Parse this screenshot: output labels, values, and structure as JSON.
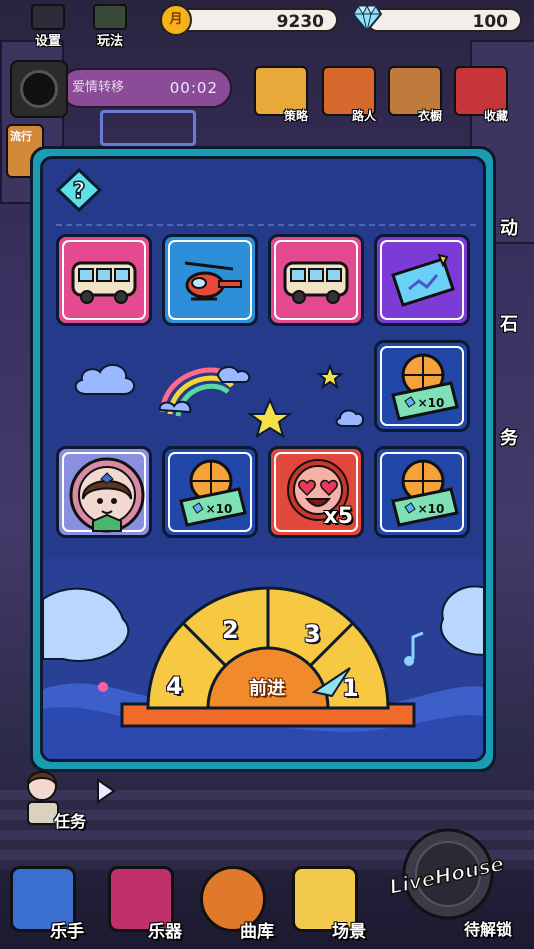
{
  "top_bar": {
    "settings_label": "设置",
    "howto_label": "玩法",
    "coin_glyph": "月",
    "coins": "9230",
    "gems": "100"
  },
  "song": {
    "title": "爱情转移",
    "time": "00:02"
  },
  "top_tabs": [
    {
      "label": "策略",
      "icon": "folder-icon",
      "color": "#e9a83a"
    },
    {
      "label": "路人",
      "icon": "passerby-icon",
      "color": "#d7692f"
    },
    {
      "label": "衣橱",
      "icon": "wardrobe-icon",
      "color": "#c07a3c"
    },
    {
      "label": "收藏",
      "icon": "gramophone-icon",
      "color": "#c6353a"
    }
  ],
  "side": {
    "left_trend_label": "流行",
    "right_partial_1": "动",
    "right_partial_2": "石",
    "right_partial_3": "务"
  },
  "board": {
    "help_glyph": "?",
    "rows": [
      [
        {
          "kind": "bus",
          "bg": "pink"
        },
        {
          "kind": "helicopter",
          "bg": "blue"
        },
        {
          "kind": "bus",
          "bg": "pink"
        },
        {
          "kind": "ticket",
          "bg": "purple"
        }
      ],
      [
        {
          "kind": "pizza-ticket",
          "bg": "navy",
          "ticket_text": "×10"
        }
      ],
      [
        {
          "kind": "avatar-badge",
          "bg": "lav"
        },
        {
          "kind": "pizza-ticket",
          "bg": "navy",
          "ticket_text": "×10"
        },
        {
          "kind": "heart-eyes-emoji",
          "bg": "red",
          "count": "x5"
        },
        {
          "kind": "pizza-ticket",
          "bg": "navy",
          "ticket_text": "×10"
        }
      ]
    ]
  },
  "dial": {
    "segments": [
      "4",
      "2",
      "3",
      "1"
    ],
    "go_label": "前进",
    "colors": {
      "yellow": "#f7c943",
      "orange": "#f08a2a",
      "base": "#f06a2a"
    }
  },
  "task_label": "任务",
  "bottom_bar": [
    {
      "label": "乐手",
      "icon": "musician-icon",
      "color": "#3a6fd0"
    },
    {
      "label": "乐器",
      "icon": "guitar-icon",
      "color": "#c0306a"
    },
    {
      "label": "曲库",
      "icon": "vinyl-icon",
      "color": "#e07a2a"
    },
    {
      "label": "场景",
      "icon": "spotlight-icon",
      "color": "#f2c94c"
    }
  ],
  "livehouse": {
    "logo_text": "LiveHouse",
    "label": "待解锁"
  }
}
